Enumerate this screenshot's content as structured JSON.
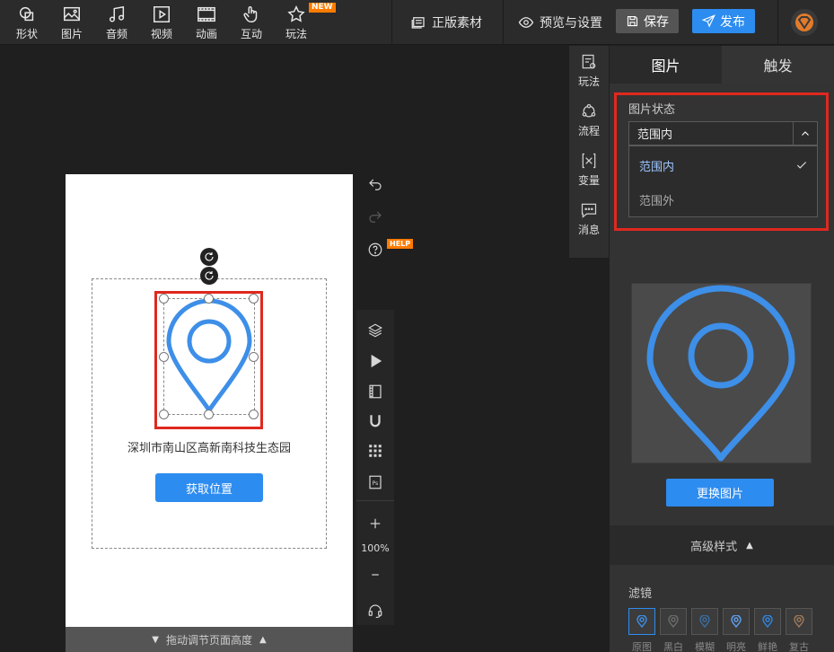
{
  "toolbar": {
    "tools": [
      {
        "label": "形状",
        "icon": "shape-icon"
      },
      {
        "label": "图片",
        "icon": "image-icon"
      },
      {
        "label": "音频",
        "icon": "music-icon"
      },
      {
        "label": "视频",
        "icon": "video-icon"
      },
      {
        "label": "动画",
        "icon": "animation-icon"
      },
      {
        "label": "互动",
        "icon": "hand-pointer-icon"
      },
      {
        "label": "玩法",
        "icon": "star-icon"
      }
    ],
    "new_badge": "NEW",
    "genuine_assets": "正版素材",
    "preview_settings": "预览与设置",
    "save": "保存",
    "publish": "发布",
    "avatar_icon": "logo-badge-icon"
  },
  "canvas": {
    "address_text": "深圳市南山区高新南科技生态园",
    "locate_button": "获取位置",
    "page_drag_label": "拖动调节页面高度",
    "pin_color": "#3d8fe8"
  },
  "side_tools": {
    "help_badge": "HELP",
    "zoom": "100%",
    "icons": [
      "undo-icon",
      "redo-icon",
      "help-icon",
      "layers-icon",
      "play-icon",
      "filmstrip-icon",
      "magnet-icon",
      "grid-icon",
      "photoshop-icon",
      "zoom-in-icon",
      "zoom-out-icon",
      "headset-icon"
    ]
  },
  "rail": {
    "items": [
      {
        "label": "玩法",
        "icon": "gameplay-icon"
      },
      {
        "label": "流程",
        "icon": "flow-icon"
      },
      {
        "label": "变量",
        "icon": "variable-icon"
      },
      {
        "label": "消息",
        "icon": "message-icon"
      }
    ]
  },
  "panel": {
    "tabs": [
      "图片",
      "触发"
    ],
    "active_tab": "图片",
    "state_label": "图片状态",
    "state_value": "范围内",
    "state_options": [
      "范围内",
      "范围外"
    ],
    "replace_button": "更换图片",
    "advanced_style": "高级样式",
    "filter_label": "滤镜",
    "filters": [
      {
        "label": "原图",
        "color": "#3d8fe8"
      },
      {
        "label": "黑白",
        "color": "#6d6d6d"
      },
      {
        "label": "模糊",
        "color": "#3b6ea6"
      },
      {
        "label": "明亮",
        "color": "#5fa4f5"
      },
      {
        "label": "鲜艳",
        "color": "#2f86e6"
      },
      {
        "label": "复古",
        "color": "#a17b5a"
      }
    ]
  }
}
